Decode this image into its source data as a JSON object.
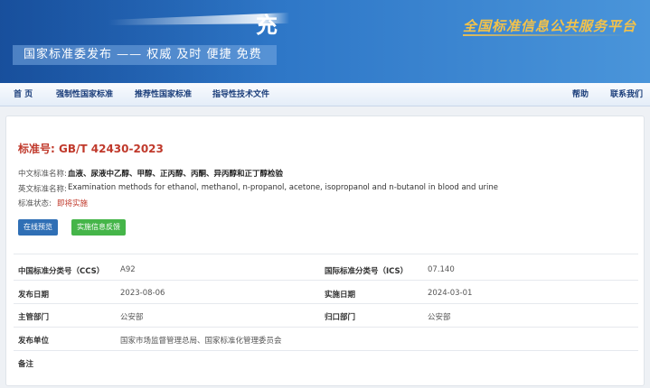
{
  "banner": {
    "header_char": "充",
    "tagline": "国家标准委发布 —— 权威 及时 便捷 免费",
    "platform_name": "全国标准信息公共服务平台"
  },
  "nav": {
    "home": "首 页",
    "mandatory": "强制性国家标准",
    "recommended": "推荐性国家标准",
    "guidance": "指导性技术文件",
    "help": "帮助",
    "contact": "联系我们"
  },
  "standard": {
    "number_label": "标准号:",
    "number": "GB/T 42430-2023",
    "cn_name_label": "中文标准名称:",
    "cn_name": "血液、尿液中乙醇、甲醇、正丙醇、丙酮、异丙醇和正丁醇检验",
    "en_name_label": "英文标准名称:",
    "en_name": "Examination methods for ethanol, methanol, n-propanol, acetone, isopropanol and n-butanol in blood and urine",
    "status_label": "标准状态:",
    "status": "即将实施"
  },
  "buttons": {
    "preview": "在线预览",
    "feedback": "实施信息反馈"
  },
  "details": {
    "ccs_label": "中国标准分类号（CCS）",
    "ccs": "A92",
    "ics_label": "国际标准分类号（ICS）",
    "ics": "07.140",
    "publish_date_label": "发布日期",
    "publish_date": "2023-08-06",
    "impl_date_label": "实施日期",
    "impl_date": "2024-03-01",
    "dept_label": "主管部门",
    "dept": "公安部",
    "central_dept_label": "归口部门",
    "central_dept": "公安部",
    "publisher_label": "发布单位",
    "publisher": "国家市场监督管理总局、国家标准化管理委员会",
    "remarks_label": "备注"
  },
  "colors": {
    "banner_blue": "#2f78c8",
    "accent_red": "#c0392b",
    "button_blue": "#2f6fb5",
    "button_green": "#45b549"
  }
}
